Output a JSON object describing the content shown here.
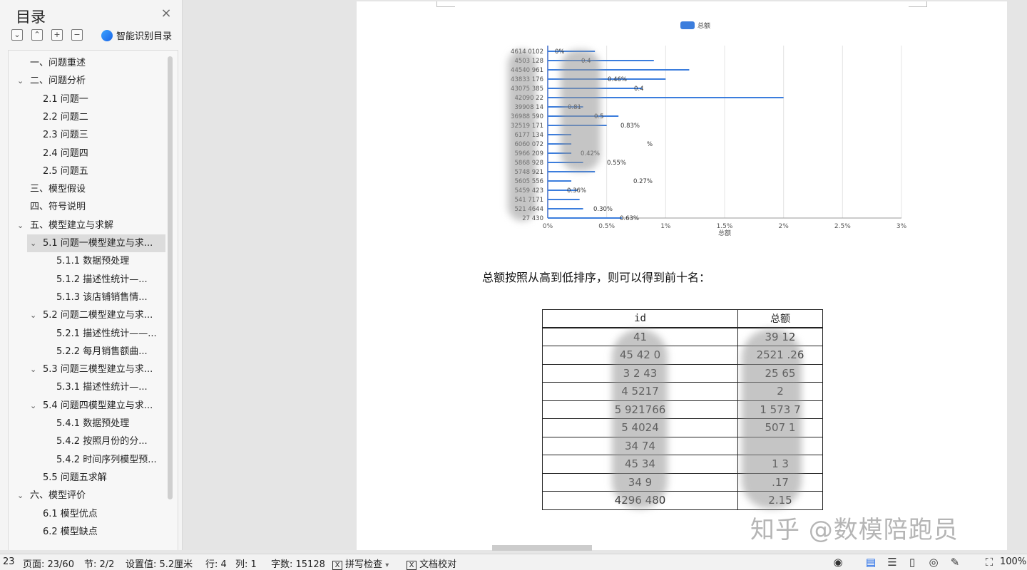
{
  "sidebar": {
    "title": "目录",
    "close_label": "×",
    "tools": [
      "⌄",
      "⌃",
      "+",
      "−"
    ],
    "smart_label": "智能识别目录",
    "toc": [
      {
        "label": "一、问题重述",
        "level": 1,
        "chev": false
      },
      {
        "label": "二、问题分析",
        "level": 1,
        "chev": true
      },
      {
        "label": "2.1 问题一",
        "level": 2,
        "chev": false
      },
      {
        "label": "2.2 问题二",
        "level": 2,
        "chev": false
      },
      {
        "label": "2.3 问题三",
        "level": 2,
        "chev": false
      },
      {
        "label": "2.4 问题四",
        "level": 2,
        "chev": false
      },
      {
        "label": "2.5 问题五",
        "level": 2,
        "chev": false
      },
      {
        "label": "三、模型假设",
        "level": 1,
        "chev": false
      },
      {
        "label": "四、符号说明",
        "level": 1,
        "chev": false
      },
      {
        "label": "五、模型建立与求解",
        "level": 1,
        "chev": true
      },
      {
        "label": "5.1 问题一模型建立与求...",
        "level": 2,
        "chev": true,
        "selected": true
      },
      {
        "label": "5.1.1  数据预处理",
        "level": 3,
        "chev": false
      },
      {
        "label": "5.1.2  描述性统计—...",
        "level": 3,
        "chev": false
      },
      {
        "label": "5.1.3  该店铺销售情...",
        "level": 3,
        "chev": false
      },
      {
        "label": "5.2 问题二模型建立与求...",
        "level": 2,
        "chev": true
      },
      {
        "label": "5.2.1 描述性统计——...",
        "level": 3,
        "chev": false
      },
      {
        "label": "5.2.2  每月销售额曲...",
        "level": 3,
        "chev": false
      },
      {
        "label": "5.3 问题三模型建立与求...",
        "level": 2,
        "chev": true
      },
      {
        "label": "5.3.1  描述性统计—...",
        "level": 3,
        "chev": false
      },
      {
        "label": "5.4  问题四模型建立与求...",
        "level": 2,
        "chev": true
      },
      {
        "label": "5.4.1 数据预处理",
        "level": 3,
        "chev": false
      },
      {
        "label": "5.4.2  按照月份的分...",
        "level": 3,
        "chev": false
      },
      {
        "label": "5.4.2 时间序列模型预...",
        "level": 3,
        "chev": false
      },
      {
        "label": "5.5  问题五求解",
        "level": 2,
        "chev": false
      },
      {
        "label": "六、模型评价",
        "level": 1,
        "chev": true
      },
      {
        "label": "6.1  模型优点",
        "level": 2,
        "chev": false
      },
      {
        "label": "6.2  模型缺点",
        "level": 2,
        "chev": false
      }
    ]
  },
  "document": {
    "paragraph": "总额按照从高到低排序，则可以得到前十名：",
    "table": {
      "headers": [
        "id",
        "总额"
      ],
      "rows": [
        [
          "41",
          "39 12"
        ],
        [
          "45 42 0",
          "2521 .26"
        ],
        [
          "3 2 43",
          "25 65"
        ],
        [
          "4 5217",
          "2"
        ],
        [
          "5 921766",
          "1 573 7"
        ],
        [
          "5 4024",
          "507 1"
        ],
        [
          "34 74",
          ""
        ],
        [
          "45 34",
          "1 3"
        ],
        [
          "34 9",
          ".17"
        ],
        [
          "4296 480",
          "2.15"
        ]
      ]
    },
    "watermark": "知乎 @数模陪跑员"
  },
  "chart_data": {
    "type": "bar",
    "orientation": "horizontal",
    "legend": [
      "总额"
    ],
    "legend_position": "top-center",
    "series_color": "#3b7ddd",
    "xlabel": "总额",
    "x_ticks": [
      "0%",
      "0.5%",
      "1%",
      "1.5%",
      "2%",
      "2.5%",
      "3%"
    ],
    "xlim": [
      0,
      3
    ],
    "grid": true,
    "y_tick_labels": [
      "4614 0102",
      "4503 128",
      "44540 961",
      "43833 176",
      "43075 385",
      "42090 22",
      "39908 14",
      "36988 590",
      "32519 171",
      "6177 134",
      "6060 072",
      "5966 209",
      "5868 928",
      "5748 921",
      "5605 556",
      "5459 423",
      "541 7171",
      "521 4644",
      "27 430"
    ],
    "visible_labels": [
      "0%",
      "0.4",
      "0.46%",
      "0.4",
      "0.81",
      "0.5",
      "0.83%",
      "%",
      "0.42%",
      "0.55%",
      "0.27%",
      "0.36%",
      "0.30%",
      "0.63%"
    ],
    "values": [
      0.4,
      0.9,
      1.2,
      1.0,
      0.8,
      2.0,
      0.3,
      0.6,
      0.5,
      0.2,
      0.2,
      0.2,
      0.3,
      0.4,
      0.2,
      0.25,
      0.27,
      0.3,
      0.63
    ]
  },
  "status_bar": {
    "page_short": "23",
    "page": "页面: 23/60",
    "section": "节: 2/2",
    "setting": "设置值: 5.2厘米",
    "row": "行: 4",
    "col": "列: 1",
    "words": "字数: 15128",
    "spell": "拼写检查",
    "spell_arrow": "▾",
    "proof": "文档校对",
    "zoom": "100%"
  }
}
